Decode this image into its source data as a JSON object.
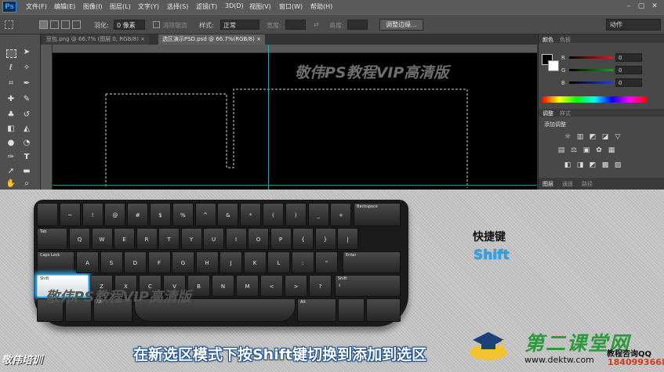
{
  "app": {
    "logo": "Ps",
    "menus": [
      "文件(F)",
      "编辑(E)",
      "图像(I)",
      "图层(L)",
      "文字(Y)",
      "选择(S)",
      "滤镜(T)",
      "3D(D)",
      "视图(V)",
      "窗口(W)",
      "帮助(H)"
    ],
    "window_controls": [
      "–",
      "▢",
      "✕"
    ]
  },
  "options_bar": {
    "feather_label": "羽化:",
    "feather_value": "0 像素",
    "antialias_label": "消除锯齿",
    "style_label": "样式:",
    "style_value": "正常",
    "width_label": "宽度:",
    "height_label": "高度:",
    "refine_button": "调整边缘...",
    "workspace": "动作"
  },
  "document_tabs": [
    {
      "label": "豆包.png @ 66.7% (图层 0, RGB/8) ×",
      "active": false
    },
    {
      "label": "选区演示PSD.psd @ 66.7%(RGB/8) ×",
      "active": true
    }
  ],
  "canvas_watermark": "敬伟PS教程VIP高清版",
  "panels": {
    "color_tabs": [
      "颜色",
      "色板"
    ],
    "channels": [
      {
        "label": "R",
        "value": "0",
        "color": "#d42020"
      },
      {
        "label": "G",
        "value": "0",
        "color": "#20a020"
      },
      {
        "label": "B",
        "value": "0",
        "color": "#2040d0"
      }
    ],
    "adjust_tabs": [
      "调整",
      "样式"
    ],
    "adjust_heading": "添加调整",
    "adjust_icons_row1": [
      "☼",
      "▥",
      "◩",
      "◪",
      "▽"
    ],
    "adjust_icons_row2": [
      "▤",
      "⚖",
      "▣",
      "✿",
      "▦"
    ],
    "adjust_icons_row3": [
      "◧",
      "◨",
      "◩",
      "▩",
      "▨"
    ],
    "layer_tabs": [
      "图层",
      "通道",
      "路径"
    ]
  },
  "keyboard": {
    "keys_row1": [
      "~",
      "!",
      "@",
      "#",
      "$",
      "%",
      "^",
      "&",
      "*",
      "(",
      ")",
      "_",
      "+"
    ],
    "keys_row2": [
      "Q",
      "W",
      "E",
      "R",
      "T",
      "Y",
      "U",
      "I",
      "O",
      "P",
      "{",
      "}",
      "|"
    ],
    "keys_row3": [
      "A",
      "S",
      "D",
      "F",
      "G",
      "H",
      "J",
      "K",
      "L",
      ":",
      "\""
    ],
    "keys_row4": [
      "Z",
      "X",
      "C",
      "V",
      "B",
      "N",
      "M",
      "<",
      ">",
      "?"
    ],
    "tab": "Tab",
    "caps": "Caps Lock",
    "enter": "Enter",
    "backspace": "Backspace",
    "shift_left": "Shift",
    "shift_right": "Shift",
    "alt_left": "Alt",
    "alt_right": "Alt",
    "shift_arrow": "⇧"
  },
  "overlay": {
    "shortcut_title": "快捷键",
    "shortcut_key": "Shift",
    "watermark": "敬伟PS教程VIP高清版",
    "brand": "敬伟培训",
    "subtitle": "在新选区模式下按Shift键切换到添加到选区",
    "site_logo": "第二课堂网",
    "site_url": "www.dektw.com",
    "contact_title": "教程咨询QQ",
    "contact_qq": "1840993668"
  }
}
